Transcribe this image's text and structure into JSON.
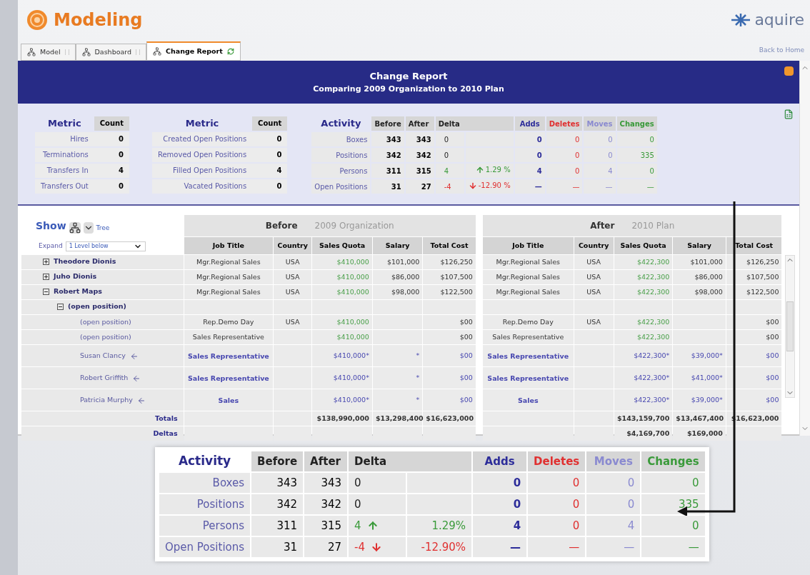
{
  "app": {
    "title": "Modeling",
    "brand": "aquire"
  },
  "tabs": [
    {
      "label": "Model",
      "selected": false
    },
    {
      "label": "Dashboard",
      "selected": false
    },
    {
      "label": "Change Report",
      "selected": true
    }
  ],
  "back_link": "Back to Home",
  "report": {
    "title": "Change Report",
    "subtitle": "Comparing 2009 Organization to 2010 Plan"
  },
  "metric_tables": [
    {
      "metric_header": "Metric",
      "count_header": "Count",
      "rows": [
        {
          "label": "Hires",
          "count": "0"
        },
        {
          "label": "Terminations",
          "count": "0"
        },
        {
          "label": "Transfers In",
          "count": "4"
        },
        {
          "label": "Transfers Out",
          "count": "0"
        }
      ]
    },
    {
      "metric_header": "Metric",
      "count_header": "Count",
      "rows": [
        {
          "label": "Created Open Positions",
          "count": "0"
        },
        {
          "label": "Removed Open Positions",
          "count": "0"
        },
        {
          "label": "Filled Open Positions",
          "count": "4"
        },
        {
          "label": "Vacated Positions",
          "count": "0"
        }
      ]
    }
  ],
  "activity_summary": {
    "title": "Activity",
    "columns": [
      {
        "label": "Before",
        "kind": "plain"
      },
      {
        "label": "After",
        "kind": "plain"
      },
      {
        "label": "Delta",
        "kind": "delta"
      },
      {
        "label": "Adds",
        "kind": "adds"
      },
      {
        "label": "Deletes",
        "kind": "deletes"
      },
      {
        "label": "Moves",
        "kind": "moves"
      },
      {
        "label": "Changes",
        "kind": "changes"
      }
    ],
    "rows": [
      {
        "label": "Boxes",
        "before": "343",
        "after": "343",
        "delta": "0",
        "kind": "steady",
        "adds": "0",
        "deletes": "0",
        "moves": "0",
        "changes": "0"
      },
      {
        "label": "Positions",
        "before": "342",
        "after": "342",
        "delta": "0",
        "kind": "steady",
        "adds": "0",
        "deletes": "0",
        "moves": "0",
        "changes": "335"
      },
      {
        "label": "Persons",
        "before": "311",
        "after": "315",
        "delta": "4",
        "kind": "increase",
        "delta_pct": "1.29 %",
        "adds": "4",
        "deletes": "0",
        "moves": "4",
        "changes": "0"
      },
      {
        "label": "Open Positions",
        "before": "31",
        "after": "27",
        "delta": "-4",
        "kind": "decrease",
        "delta_pct": "-12.90 %",
        "adds": "—",
        "deletes": "—",
        "moves": "—",
        "changes": "—"
      }
    ]
  },
  "grid": {
    "show_label": "Show",
    "tree_label": "Tree",
    "expand_label": "Expand",
    "expand_value": "1 Level below",
    "before": {
      "label": "Before",
      "plan": "2009 Organization",
      "columns": [
        "Job Title",
        "Country",
        "Sales Quota",
        "Salary",
        "Total Cost"
      ]
    },
    "after": {
      "label": "After",
      "plan": "2010 Plan",
      "columns": [
        "Job Title",
        "Country",
        "Sales Quota",
        "Salary",
        "Total Cost"
      ]
    },
    "tree": [
      {
        "name": "Theodore Dionis",
        "expanded": false,
        "before": {
          "job_title": "Mgr.Regional Sales",
          "country": "USA",
          "sales_quota": "$410,000",
          "salary": "$101,000",
          "total_cost": "$126,250"
        },
        "after": {
          "job_title": "Mgr.Regional Sales",
          "country": "USA",
          "sales_quota": "$422,300",
          "salary": "$101,000",
          "total_cost": "$126,250"
        }
      },
      {
        "name": "Juho Dionis",
        "expanded": false,
        "before": {
          "job_title": "Mgr.Regional Sales",
          "country": "USA",
          "sales_quota": "$410,000",
          "salary": "$86,000",
          "total_cost": "$107,500"
        },
        "after": {
          "job_title": "Mgr.Regional Sales",
          "country": "USA",
          "sales_quota": "$422,300",
          "salary": "$86,000",
          "total_cost": "$107,500"
        }
      },
      {
        "name": "Robert Maps",
        "expanded": true,
        "before": {
          "job_title": "Mgr.Regional Sales",
          "country": "USA",
          "sales_quota": "$410,000",
          "salary": "$98,000",
          "total_cost": "$122,500"
        },
        "after": {
          "job_title": "Mgr.Regional Sales",
          "country": "USA",
          "sales_quota": "$422,300",
          "salary": "$98,000",
          "total_cost": "$122,500"
        },
        "children": [
          {
            "name": "(open position)",
            "expanded": true,
            "children": [
              {
                "name": "(open position)",
                "before": {
                  "job_title": "Rep.Demo Day",
                  "country": "USA",
                  "sales_quota": "$410,000",
                  "total_cost": "$00"
                },
                "after": {
                  "job_title": "Rep.Demo Day",
                  "country": "USA",
                  "sales_quota": "$422,300",
                  "total_cost": "$00"
                }
              },
              {
                "name": "(open position)",
                "before": {
                  "job_title": "Sales Representative",
                  "sales_quota": "$410,000",
                  "total_cost": "$00"
                },
                "after": {
                  "job_title": "Sales Representative",
                  "sales_quota": "$422,300",
                  "total_cost": "$00"
                }
              },
              {
                "name": "Susan Clancy",
                "moved": true,
                "changed": true,
                "before": {
                  "job_title": "Sales Representative",
                  "sales_quota": "$410,000*",
                  "salary": "*",
                  "total_cost": "$00"
                },
                "after": {
                  "job_title": "Sales Representative",
                  "sales_quota": "$422,300*",
                  "salary": "$39,000*",
                  "total_cost": "$00"
                }
              },
              {
                "name": "Robert Griffith",
                "moved": true,
                "changed": true,
                "before": {
                  "job_title": "Sales Representative",
                  "sales_quota": "$410,000*",
                  "salary": "*",
                  "total_cost": "$00"
                },
                "after": {
                  "job_title": "Sales Representative",
                  "sales_quota": "$422,300*",
                  "salary": "$41,000*",
                  "total_cost": "$00"
                }
              },
              {
                "name": "Patricia Murphy",
                "moved": true,
                "changed": true,
                "before": {
                  "job_title": "Sales",
                  "sales_quota": "$410,000*",
                  "salary": "*",
                  "total_cost": "$00"
                },
                "after": {
                  "job_title": "Sales",
                  "sales_quota": "$422,300*",
                  "salary": "$39,000*",
                  "total_cost": "$00"
                }
              }
            ]
          }
        ]
      }
    ],
    "totals": {
      "label": "Totals",
      "before": {
        "sales_quota": "$138,990,000",
        "salary": "$13,298,400",
        "total_cost": "$16,623,000"
      },
      "after": {
        "sales_quota": "$143,159,700",
        "salary": "$13,467,400",
        "total_cost": "$16,623,000"
      }
    },
    "deltas": {
      "label": "Deltas",
      "after": {
        "sales_quota": "$4,169,700",
        "salary": "$169,000"
      }
    }
  },
  "activity_callout": {
    "title": "Activity",
    "columns": [
      {
        "label": "Before",
        "kind": "plain"
      },
      {
        "label": "After",
        "kind": "plain"
      },
      {
        "label": "Delta",
        "kind": "delta"
      },
      {
        "label": "Adds",
        "kind": "adds"
      },
      {
        "label": "Deletes",
        "kind": "deletes"
      },
      {
        "label": "Moves",
        "kind": "moves"
      },
      {
        "label": "Changes",
        "kind": "changes"
      }
    ],
    "rows": [
      {
        "label": "Boxes",
        "before": "343",
        "after": "343",
        "delta": "0",
        "kind": "steady",
        "adds": "0",
        "deletes": "0",
        "moves": "0",
        "changes": "0"
      },
      {
        "label": "Positions",
        "before": "342",
        "after": "342",
        "delta": "0",
        "kind": "steady",
        "adds": "0",
        "deletes": "0",
        "moves": "0",
        "changes": "335"
      },
      {
        "label": "Persons",
        "before": "311",
        "after": "315",
        "delta": "4",
        "kind": "increase",
        "delta_pct": "1.29%",
        "adds": "4",
        "deletes": "0",
        "moves": "4",
        "changes": "0"
      },
      {
        "label": "Open Positions",
        "before": "31",
        "after": "27",
        "delta": "-4",
        "kind": "decrease",
        "delta_pct": "-12.90%",
        "adds": "—",
        "deletes": "—",
        "moves": "—",
        "changes": "—"
      }
    ]
  }
}
